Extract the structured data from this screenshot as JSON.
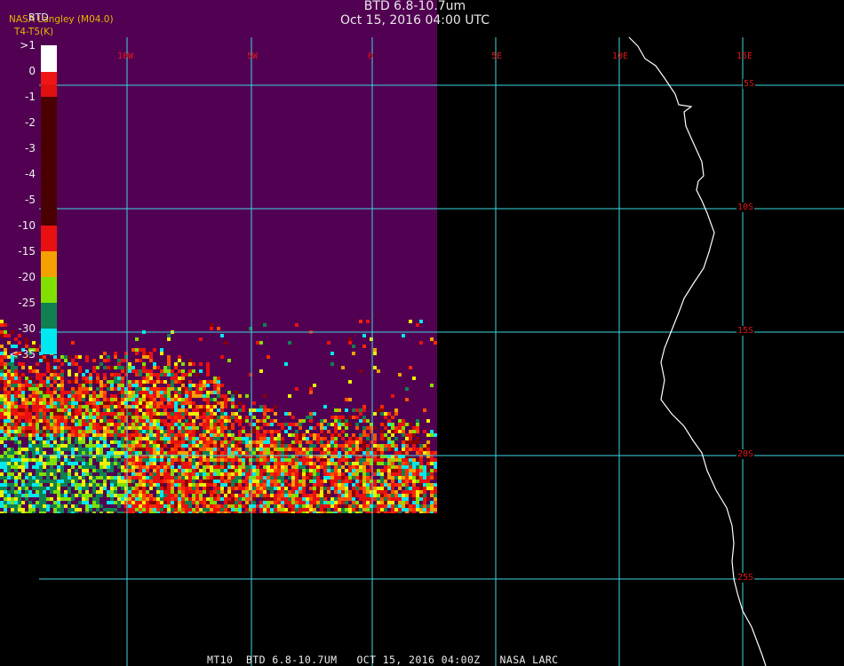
{
  "header": {
    "title": "BTD 6.8-10.7um",
    "timestamp": "Oct 15, 2016 04:00 UTC",
    "agency": "NASA Langley (M04.0)",
    "units": "T4-T5(K)",
    "colorbar_title": "BTD"
  },
  "colorbar": {
    "labels": [
      ">1",
      "0",
      "-1",
      "-2",
      "-3",
      "-4",
      "-5",
      "-10",
      "-15",
      "-20",
      "-25",
      "-30",
      "<-35"
    ]
  },
  "grid": {
    "lon_labels": [
      "10W",
      "5W",
      "0",
      "5E",
      "10E",
      "15E"
    ],
    "lat_labels": [
      "5S",
      "10S",
      "15S",
      "20S",
      "25S"
    ]
  },
  "footer": "MT10  BTD 6.8-10.7UM   OCT 15, 2016 04:00Z   NASA LARC",
  "colors": {
    "no_data_background": "#520052",
    "grid": "#3ed8e0",
    "coastline": "#ffffff",
    "grid_label": "#e01818",
    "colorbar_scale": [
      "#ffffff",
      "#e01010",
      "#5a0808",
      "#3c0000",
      "#3c0000",
      "#3c0000",
      "#3c0000",
      "#e81010",
      "#f4a000",
      "#80e000",
      "#108050",
      "#00e8f0"
    ]
  }
}
